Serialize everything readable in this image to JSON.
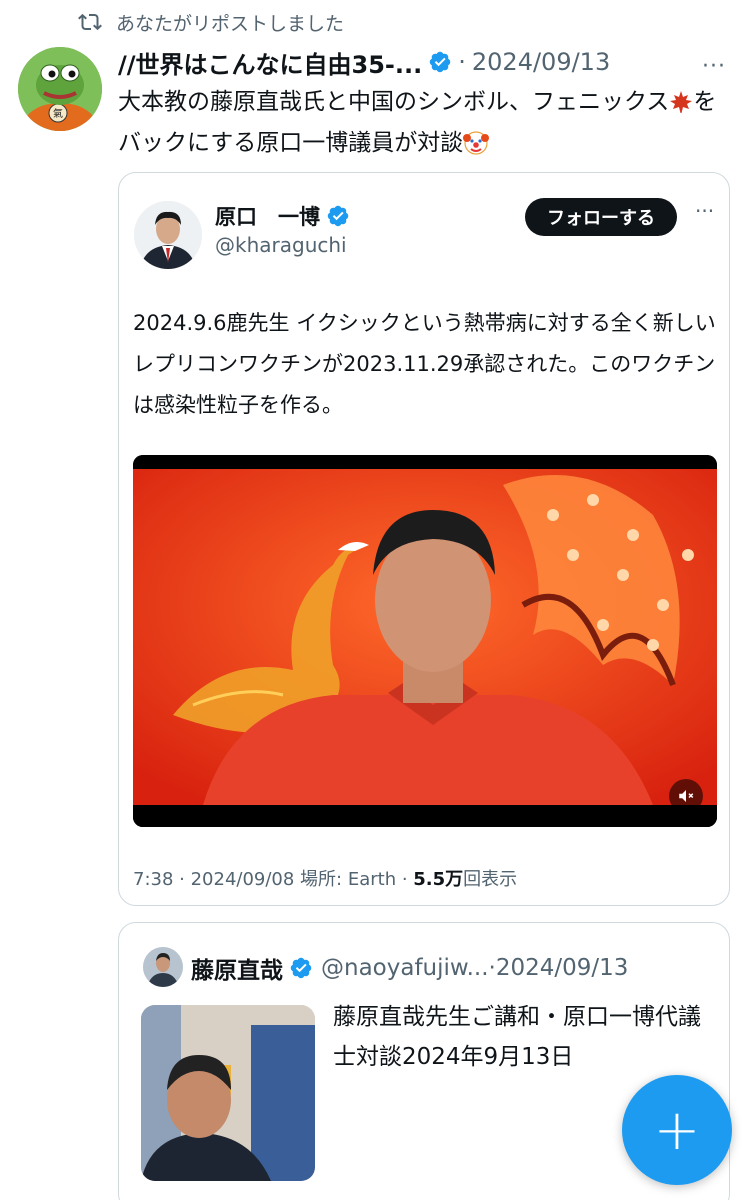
{
  "repost": {
    "label": "あなたがリポストしました"
  },
  "tweet": {
    "author": "//世界はこんなに自由35-...",
    "dot": "·",
    "date": "2024/09/13",
    "more": "···",
    "text_a": "大本教の藤原直哉氏と中国のシンボル、フェニックス",
    "text_b": "をバックにする原口一博議員が対談",
    "emoji_leaf": "🍁",
    "emoji_clown": "🤡"
  },
  "quoted": {
    "name": "原口　一博",
    "handle": "@kharaguchi",
    "follow_label": "フォローする",
    "more": "···",
    "body": "2024.9.6鹿先生 イクシックという熱帯病に対する全く新しいレプリコンワクチンが2023.11.29承認された。このワクチンは感染性粒子を作る。",
    "meta_time": "7:38 · 2024/09/08 場所: Earth · ",
    "meta_views_num": "5.5万",
    "meta_views_label": "回表示"
  },
  "quoted2": {
    "name": "藤原直哉",
    "handle": "@naoyafujiw...",
    "dot": "·",
    "date": "2024/09/13",
    "text": "藤原直哉先生ご講和・原口一博代議士対談2024年9月13日"
  },
  "fab": {
    "label": "+"
  },
  "colors": {
    "accent": "#1d9bf0",
    "text": "#0f1419",
    "muted": "#536471",
    "border": "#cfd9de"
  },
  "icons": [
    "repost-icon",
    "verified-badge-icon",
    "more-icon",
    "mute-icon",
    "compose-icon"
  ]
}
